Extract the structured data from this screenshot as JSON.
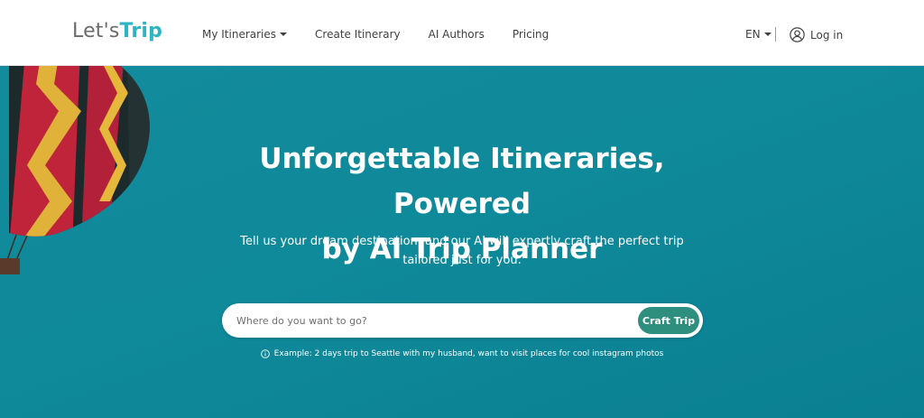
{
  "header": {
    "logo": {
      "lets": "Let's",
      "trip": "Trip"
    },
    "nav": [
      {
        "label": "My Itineraries",
        "has_dropdown": true
      },
      {
        "label": "Create Itinerary"
      },
      {
        "label": "AI Authors"
      },
      {
        "label": "Pricing"
      }
    ],
    "language": "EN",
    "login_label": "Log in"
  },
  "hero": {
    "title_line1": "Unforgettable Itineraries, Powered",
    "title_line2": "by AI Trip Planner",
    "subtitle_line1": "Tell us your dream destination, and our AI will expertly craft the perfect trip",
    "subtitle_line2": "tailored just for you.",
    "search": {
      "placeholder": "Where do you want to go?",
      "value": "",
      "button_label": "Craft Trip"
    },
    "example": "Example: 2 days trip to Seattle with my husband, want to visit places for cool instagram photos"
  },
  "colors": {
    "accent": "#2db5c4",
    "hero_bg": "#0f8a9a",
    "button": "#2e8f7f"
  },
  "icons": [
    "user-circle-icon",
    "info-icon",
    "caret-down-icon"
  ]
}
